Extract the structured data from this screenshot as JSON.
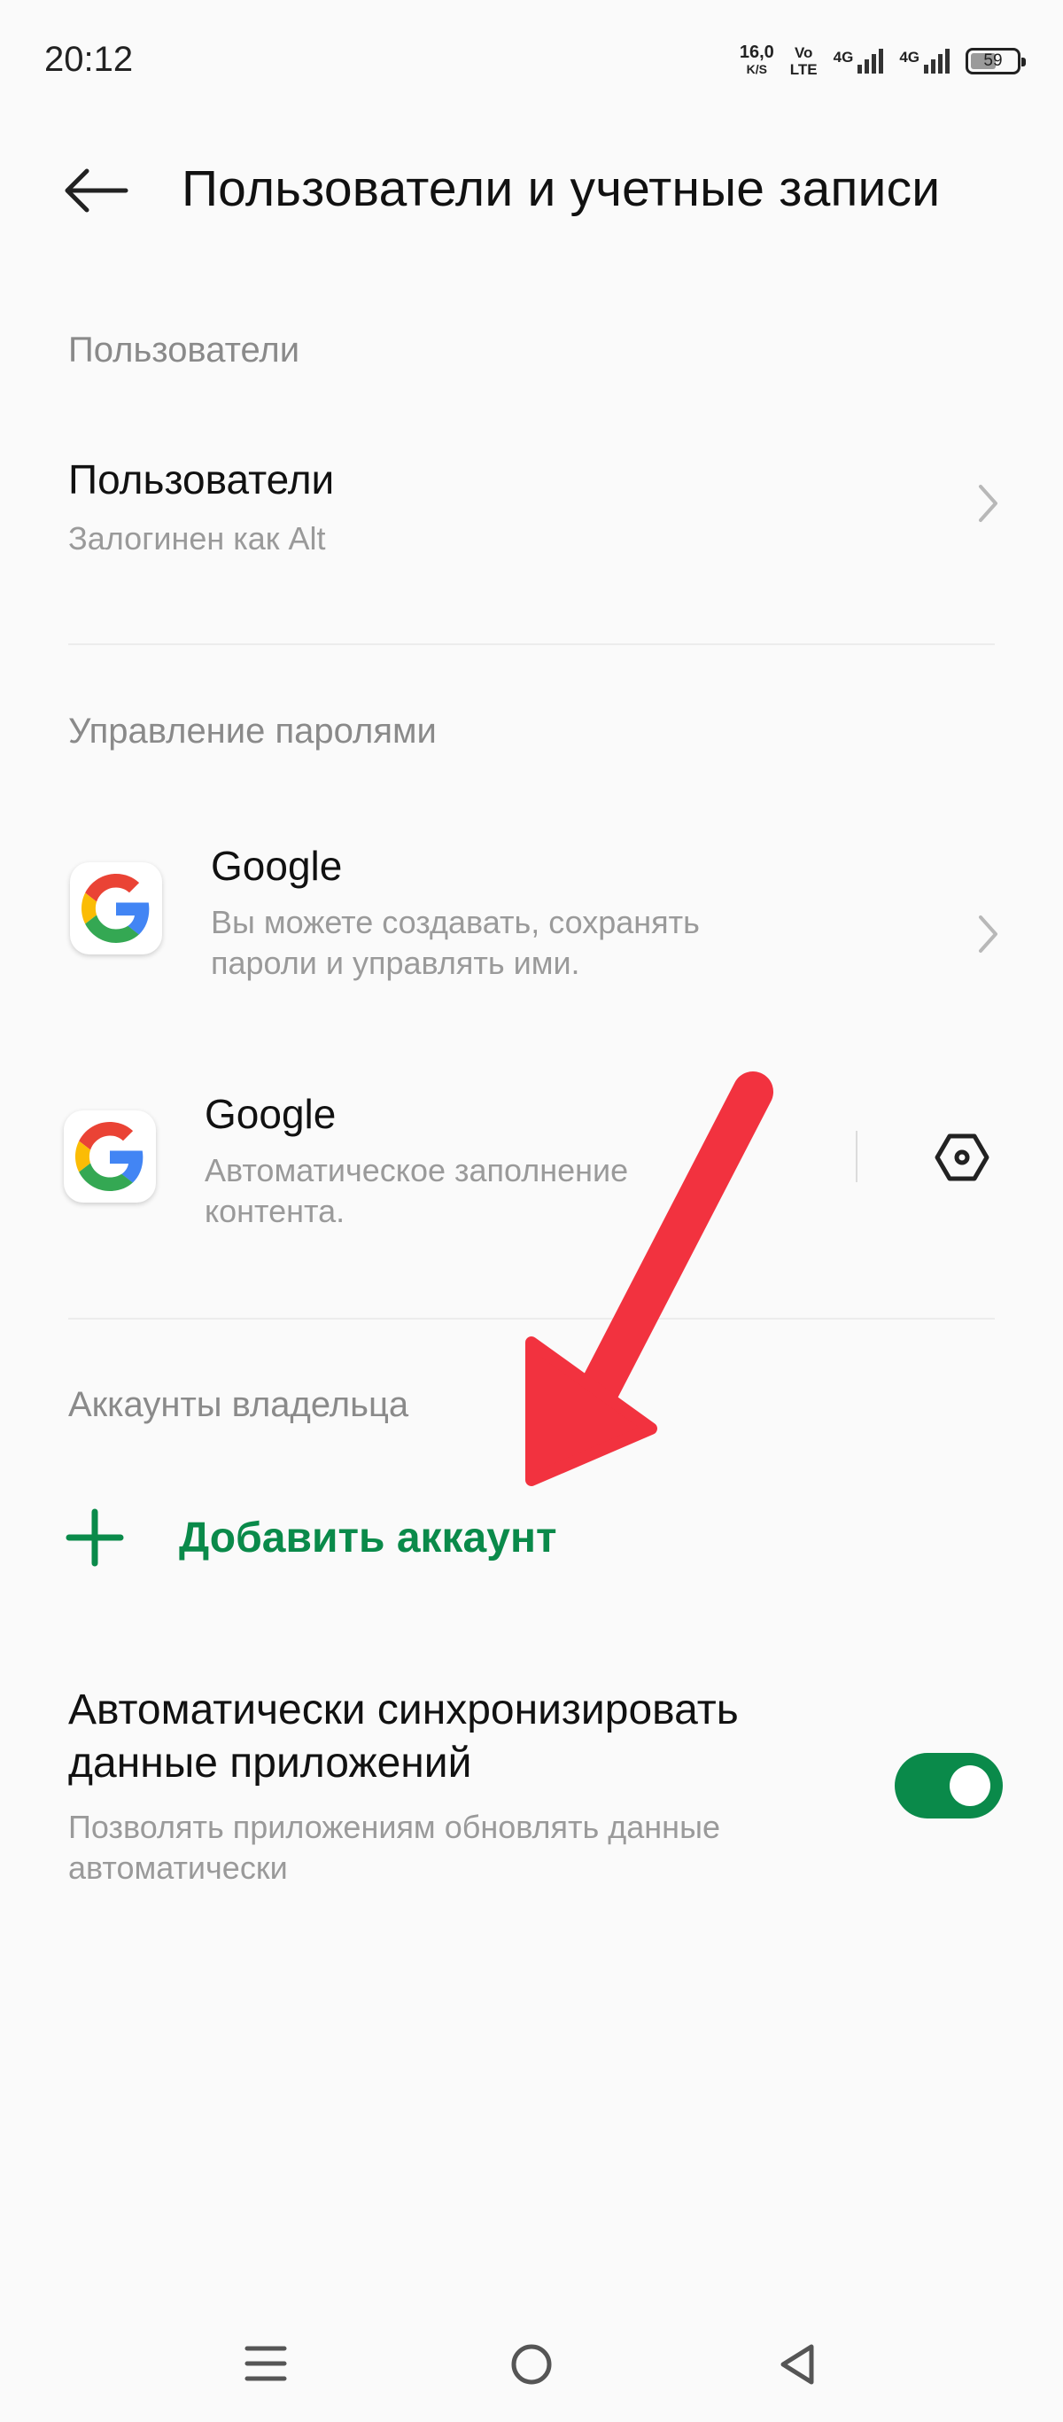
{
  "status_bar": {
    "time": "20:12",
    "net_speed_value": "16,0",
    "net_speed_unit": "K/S",
    "volte_top": "Vo",
    "volte_bottom": "LTE",
    "signal1_label": "4G",
    "signal2_label": "4G",
    "battery": "59"
  },
  "header": {
    "title": "Пользователи и учетные записи",
    "back_icon": "arrow-left-icon"
  },
  "users_section": {
    "header": "Пользователи",
    "item": {
      "title": "Пользователи",
      "subtitle": "Залогинен как Alt",
      "icon": "chevron-right-icon"
    }
  },
  "passwords_section": {
    "header": "Управление паролями",
    "items": [
      {
        "title": "Google",
        "subtitle_line1": "Вы можете создавать, сохранять",
        "subtitle_line2": "пароли и управлять ими.",
        "icon": "google-icon",
        "trailing_icon": "chevron-right-icon"
      },
      {
        "title": "Google",
        "subtitle_line1": "Автоматическое заполнение",
        "subtitle_line2": "контента.",
        "icon": "google-icon",
        "trailing_icon": "settings-hexagon-icon"
      }
    ]
  },
  "owner_section": {
    "header": "Аккаунты владельца",
    "add_account": "Добавить аккаунт",
    "add_icon": "plus-icon"
  },
  "sync": {
    "title_line1": "Автоматически синхронизировать",
    "title_line2": "данные приложений",
    "subtitle_line1": "Позволять приложениям обновлять данные",
    "subtitle_line2": "автоматически",
    "enabled": true
  },
  "nav_bar": {
    "icons": [
      "menu-icon",
      "home-icon",
      "back-icon"
    ]
  },
  "colors": {
    "accent": "#0a8a4a",
    "annotation_arrow": "#f2323f"
  }
}
